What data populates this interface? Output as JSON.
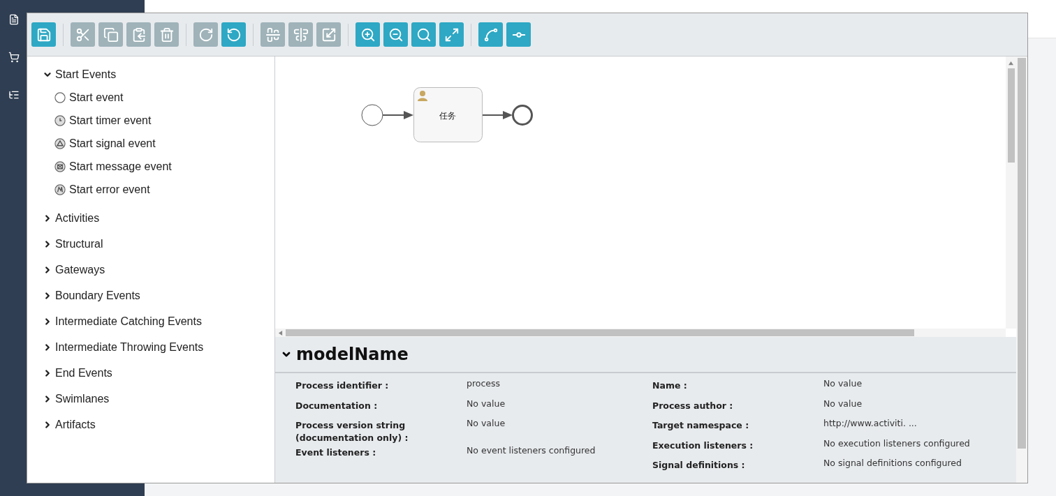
{
  "toolbar": {
    "groups": [
      [
        {
          "disabled": false
        }
      ],
      [
        {
          "disabled": true
        },
        {
          "disabled": true
        },
        {
          "disabled": true
        },
        {
          "disabled": true
        }
      ],
      [
        {
          "disabled": true
        },
        {
          "disabled": false
        }
      ],
      [
        {
          "disabled": true
        },
        {
          "disabled": true
        },
        {
          "disabled": true
        }
      ],
      [
        {
          "disabled": false
        },
        {
          "disabled": false
        },
        {
          "disabled": false
        },
        {
          "disabled": false
        }
      ],
      [
        {
          "disabled": false
        },
        {
          "disabled": false
        }
      ]
    ]
  },
  "palette": [
    {
      "label": "Start Events",
      "expanded": true,
      "items": [
        {
          "label": "Start event",
          "kind": "none"
        },
        {
          "label": "Start timer event",
          "kind": "timer"
        },
        {
          "label": "Start signal event",
          "kind": "signal"
        },
        {
          "label": "Start message event",
          "kind": "message"
        },
        {
          "label": "Start error event",
          "kind": "error"
        }
      ]
    },
    {
      "label": "Activities",
      "expanded": false
    },
    {
      "label": "Structural",
      "expanded": false
    },
    {
      "label": "Gateways",
      "expanded": false
    },
    {
      "label": "Boundary Events",
      "expanded": false
    },
    {
      "label": "Intermediate Catching Events",
      "expanded": false
    },
    {
      "label": "Intermediate Throwing Events",
      "expanded": false
    },
    {
      "label": "End Events",
      "expanded": false
    },
    {
      "label": "Swimlanes",
      "expanded": false
    },
    {
      "label": "Artifacts",
      "expanded": false
    }
  ],
  "diagram": {
    "task": {
      "label": "任务"
    }
  },
  "properties": {
    "title": "modelName",
    "expanded": true,
    "columns": [
      [
        {
          "label": "Process identifier :",
          "value": "process"
        },
        {
          "label": "Documentation :",
          "value": "No value"
        },
        {
          "label": "Process version string (documentation only) :",
          "value": "No value"
        },
        {
          "label": "Event listeners :",
          "value": "No event listeners configured"
        }
      ],
      [
        {
          "label": "Name :",
          "value": "No value"
        },
        {
          "label": "Process author :",
          "value": "No value"
        },
        {
          "label": "Target namespace :",
          "value": "http://www.activiti. ..."
        },
        {
          "label": "Execution listeners :",
          "value": "No execution listeners configured"
        },
        {
          "label": "Signal definitions :",
          "value": "No signal definitions configured"
        }
      ]
    ]
  }
}
